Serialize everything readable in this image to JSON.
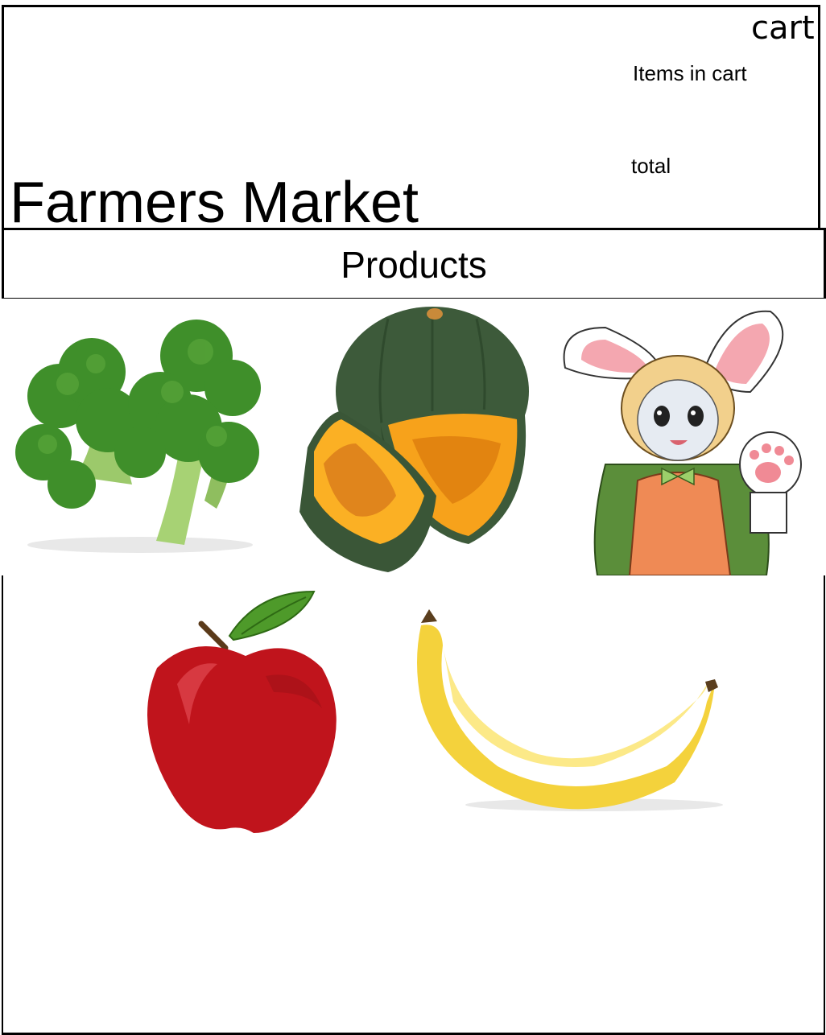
{
  "header": {
    "cart_title": "cart",
    "items_label": "Items in cart",
    "total_label": "total",
    "site_title": "Farmers Market"
  },
  "products_section": {
    "title": "Products"
  },
  "products": [
    {
      "icon": "broccoli-image"
    },
    {
      "icon": "pumpkin-image"
    },
    {
      "icon": "bunny-girl-image"
    },
    {
      "icon": "apple-image"
    },
    {
      "icon": "banana-image"
    }
  ],
  "colors": {
    "border": "#000000",
    "background": "#ffffff",
    "broccoli": "#3f8f2a",
    "pumpkin_skin": "#3d5a3a",
    "pumpkin_flesh": "#f7a21b",
    "apple": "#c0141c",
    "banana": "#f4d23c"
  }
}
